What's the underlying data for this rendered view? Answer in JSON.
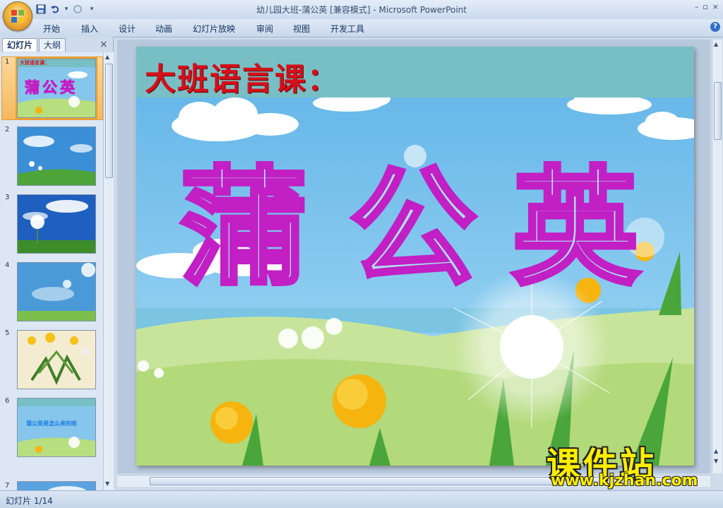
{
  "window": {
    "title": "幼儿园大班-蒲公英 [兼容模式] - Microsoft PowerPoint",
    "controls": [
      "–",
      "▫",
      "×"
    ]
  },
  "quick_access": {
    "icons": [
      "save-icon",
      "undo-icon",
      "redo-icon",
      "customize-icon"
    ],
    "undo_arrow": "▾"
  },
  "ribbon": {
    "tabs": [
      "开始",
      "插入",
      "设计",
      "动画",
      "幻灯片放映",
      "审阅",
      "视图",
      "开发工具"
    ],
    "help": "?"
  },
  "left_pane": {
    "tabs": [
      "幻灯片",
      "大纲"
    ],
    "close": "×",
    "slides": [
      {
        "num": "1",
        "title": "大班语言课：",
        "big": "蒲公英",
        "selected": true
      },
      {
        "num": "2"
      },
      {
        "num": "3"
      },
      {
        "num": "4"
      },
      {
        "num": "5"
      },
      {
        "num": "6",
        "title": "蒲公英是怎么来的呢"
      },
      {
        "num": "7"
      }
    ]
  },
  "slide": {
    "title": "大班语言课：",
    "word": [
      "蒲",
      "公",
      "英"
    ],
    "colors": {
      "title": "#d4101a",
      "word_outline": "#c21fc4",
      "banner": "#77bfc4",
      "sky": "#7cc2ea",
      "grass": "#b7de7f"
    }
  },
  "watermark": {
    "cn": "课件站",
    "url": "www.kjzhan.com"
  },
  "statusbar": {
    "text": "幻灯片 1/14"
  }
}
